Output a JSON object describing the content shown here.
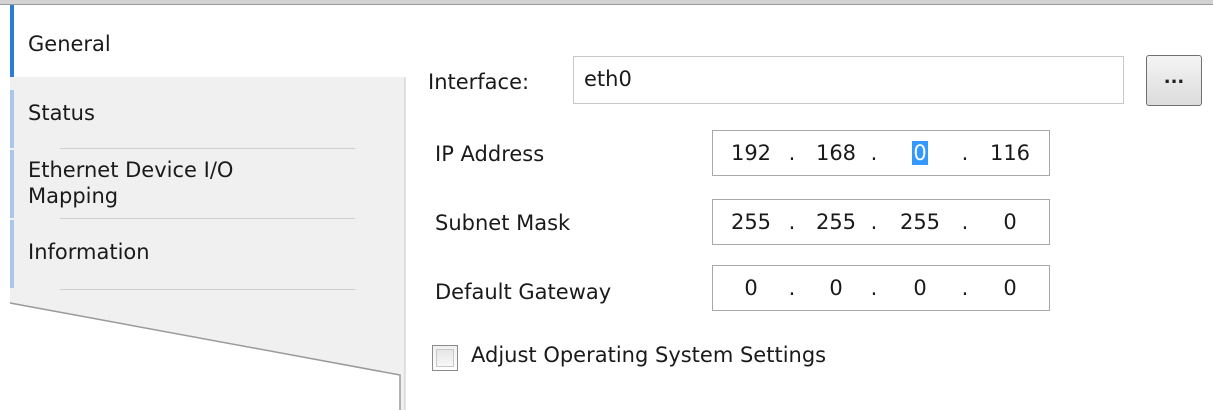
{
  "nav": {
    "items": [
      {
        "label": "General",
        "selected": true
      },
      {
        "label": "Status",
        "selected": false
      },
      {
        "label": "Ethernet Device I/O\nMapping",
        "selected": false
      },
      {
        "label": "Information",
        "selected": false
      }
    ]
  },
  "form": {
    "interface_label": "Interface:",
    "interface_value": "eth0",
    "browse_label": "...",
    "ip_label": "IP Address",
    "ip_octets": [
      "192",
      "168",
      "0",
      "116"
    ],
    "subnet_label": "Subnet Mask",
    "subnet_octets": [
      "255",
      "255",
      "255",
      "0"
    ],
    "gateway_label": "Default Gateway",
    "gateway_octets": [
      "0",
      "0",
      "0",
      "0"
    ],
    "octet_separator": ".",
    "adjust_os_label": "Adjust Operating System Settings",
    "adjust_os_checked": false
  },
  "colors": {
    "selected_accent": "#2b7cd3",
    "nav_accent": "#a9c7e8",
    "nav_background": "#f0f0f0",
    "selection_highlight": "#3399ff"
  }
}
